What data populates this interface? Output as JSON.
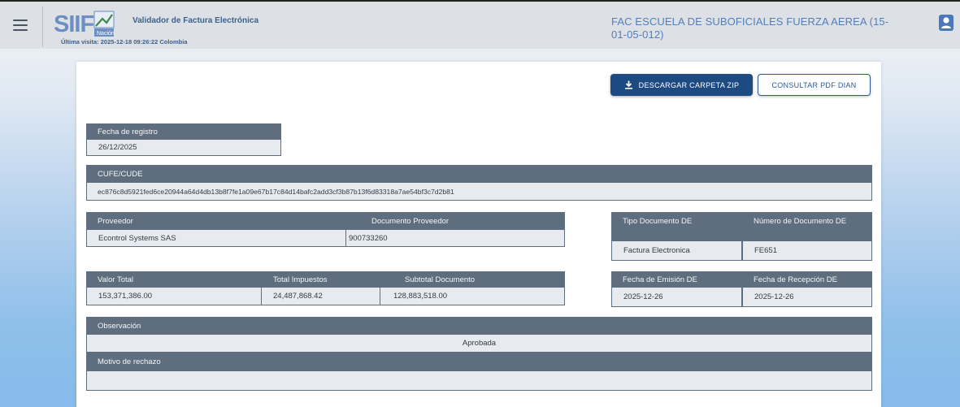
{
  "header": {
    "app_title": "Validador de Factura Electrónica",
    "last_visit": "Última visita: 2025-12-18 09:26:22 Colombia",
    "entity_name": "FAC ESCUELA DE SUBOFICIALES FUERZA AEREA (15-01-05-012)",
    "logo_text": "SIIF Nación"
  },
  "actions": {
    "download_zip": "DESCARGAR CARPETA ZIP",
    "consult_pdf": "CONSULTAR PDF DIAN"
  },
  "fields": {
    "fecha_registro": {
      "label": "Fecha de registro",
      "value": "26/12/2025"
    },
    "cufe": {
      "label": "CUFE/CUDE",
      "value": "ec876c8d5921fed6ce20944a64d4db13b8f7fe1a09e67b17c84d14bafc2add3cf3b87b13f6d83318a7ae54bf3c7d2b81"
    },
    "proveedor": {
      "label": "Proveedor",
      "value": "Econtrol Systems SAS"
    },
    "documento_proveedor": {
      "label": "Documento Proveedor",
      "value": "900733260"
    },
    "tipo_documento": {
      "label": "Tipo Documento DE",
      "value": "Factura Electronica"
    },
    "numero_documento": {
      "label": "Número de Documento DE",
      "value": "FE651"
    },
    "valor_total": {
      "label": "Valor Total",
      "value": "153,371,386.00"
    },
    "total_impuestos": {
      "label": "Total Impuestos",
      "value": "24,487,868.42"
    },
    "subtotal": {
      "label": "Subtotal Documento",
      "value": "128,883,518.00"
    },
    "fecha_emision": {
      "label": "Fecha de Emisión DE",
      "value": "2025-12-26"
    },
    "fecha_recepcion": {
      "label": "Fecha de Recepción DE",
      "value": "2025-12-26"
    },
    "observacion": {
      "label": "Observación",
      "value": "Aprobada"
    },
    "motivo_rechazo": {
      "label": "Motivo de rechazo",
      "value": ""
    }
  },
  "colors": {
    "header_bg": "#dde1e6",
    "primary": "#1e4a82",
    "label_bg": "#5f6e7e",
    "value_bg": "#e7eaee",
    "entity_text": "#4f7fbf"
  },
  "icons": [
    "menu-icon",
    "user-icon",
    "download-icon"
  ]
}
